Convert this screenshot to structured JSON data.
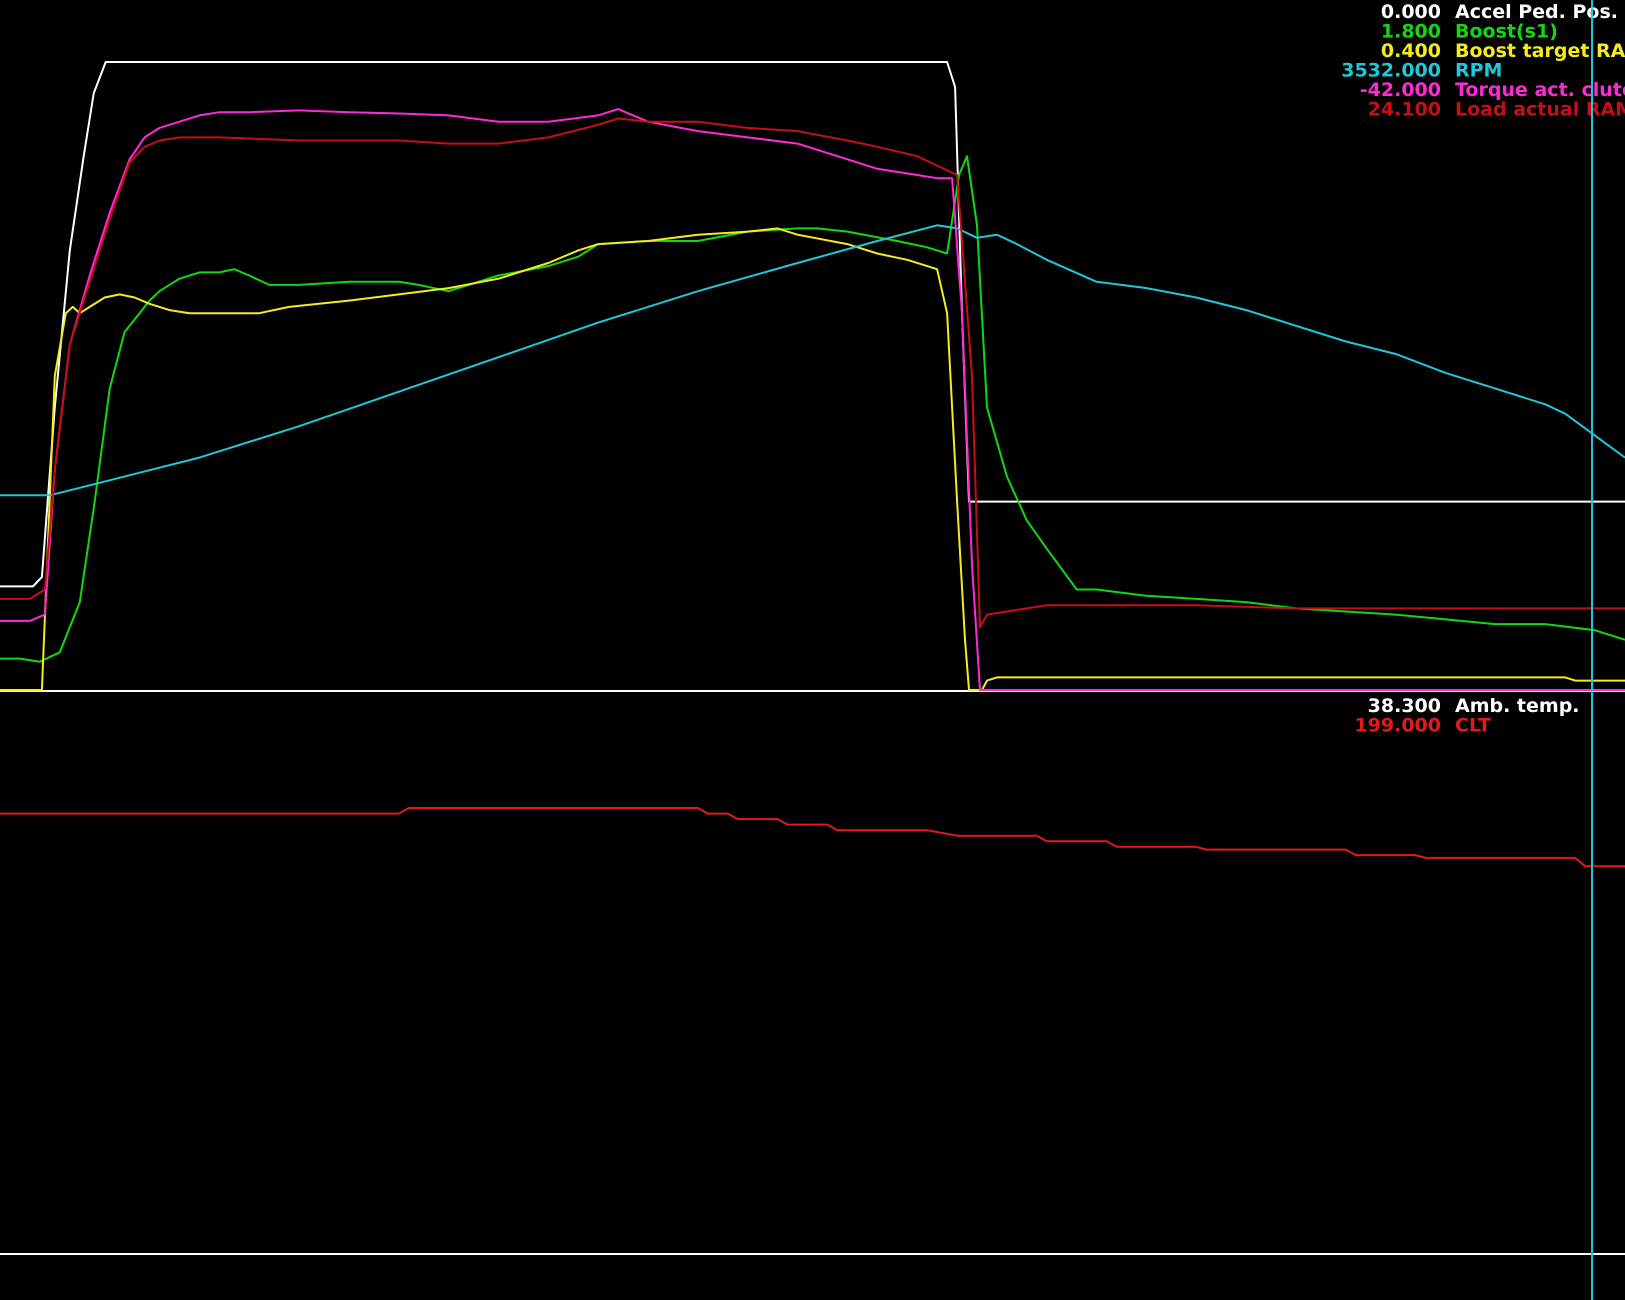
{
  "window": {
    "background": "#000000"
  },
  "cursor": {
    "color": "#1fc8d8",
    "x_fraction": 0.9797
  },
  "chart_data": [
    {
      "type": "line",
      "panel": "upper",
      "title": "",
      "xlabel": "",
      "ylabel": "",
      "legend_position": "top-right",
      "x_range": [
        0,
        163
      ],
      "y_range": [
        0,
        100
      ],
      "baseline_color": "#ffffff",
      "series": [
        {
          "name": "Accel Ped. Pos.",
          "cursor_value": "0.000",
          "color": "#ffffff",
          "x": [
            0,
            3.3,
            4.2,
            5.5,
            7,
            8.4,
            9.4,
            10.6,
            95,
            95.8,
            96.5,
            97.2,
            163
          ],
          "y": [
            16.5,
            16.5,
            18,
            45,
            70,
            85,
            95,
            100,
            100,
            96,
            60,
            30,
            30
          ]
        },
        {
          "name": "Boost(s1)",
          "cursor_value": "1.800",
          "color": "#11d911",
          "x": [
            0,
            2,
            4,
            6,
            8,
            9.5,
            11,
            12.5,
            14,
            15,
            16,
            18,
            20,
            22,
            23.5,
            25,
            27,
            30,
            35,
            40,
            42,
            45,
            50,
            55,
            58,
            60,
            65,
            70,
            75,
            80,
            82,
            85,
            90,
            93,
            95,
            96.2,
            97,
            98,
            99,
            101,
            103,
            105,
            108,
            110,
            115,
            120,
            125,
            130,
            140,
            150,
            155,
            160,
            163
          ],
          "y": [
            5,
            5,
            4.5,
            6,
            14,
            30,
            48,
            57,
            60,
            62,
            63.5,
            65.5,
            66.5,
            66.5,
            67,
            66,
            64.5,
            64.5,
            65,
            65,
            64.5,
            63.5,
            66,
            67.5,
            69,
            71,
            71.5,
            71.5,
            73,
            73.5,
            73.5,
            73,
            71.5,
            70.5,
            69.5,
            82,
            85,
            74,
            45,
            34,
            27,
            22.5,
            16,
            16,
            15,
            14.5,
            14,
            13,
            12,
            10.5,
            10.5,
            9.5,
            8
          ]
        },
        {
          "name": "Boost target RAM",
          "cursor_value": "0.400",
          "color": "#f5ec1f",
          "x": [
            0,
            4.2,
            5.5,
            6.6,
            7.3,
            8,
            9,
            10.5,
            12,
            13.5,
            15,
            17,
            19,
            20.5,
            22,
            24,
            26,
            29,
            35,
            40,
            45,
            50,
            55,
            58,
            60,
            65,
            70,
            75,
            78,
            80,
            85,
            88,
            91,
            94,
            95,
            96,
            96.8,
            97.2,
            98.5,
            99,
            100,
            110,
            120,
            130,
            140,
            150,
            157,
            158,
            163
          ],
          "y": [
            0,
            0,
            50,
            60,
            61,
            60,
            61,
            62.5,
            63,
            62.5,
            61.5,
            60.5,
            60,
            60,
            60,
            60,
            60,
            61,
            62,
            63,
            64,
            65.5,
            68,
            70,
            71,
            71.5,
            72.5,
            73,
            73.5,
            72.5,
            71,
            69.5,
            68.5,
            67,
            60,
            30,
            8,
            0,
            0,
            1.5,
            2,
            2,
            2,
            2,
            2,
            2,
            2,
            1.5,
            1.5
          ]
        },
        {
          "name": "RPM",
          "cursor_value": "3532.000",
          "color": "#1fc8d8",
          "x": [
            0,
            5,
            10,
            20,
            30,
            40,
            50,
            60,
            70,
            80,
            88,
            94,
            96,
            98,
            100,
            102,
            105,
            110,
            115,
            120,
            125,
            130,
            135,
            140,
            145,
            150,
            155,
            157,
            160,
            163
          ],
          "y": [
            31,
            31,
            33,
            37,
            42,
            47.5,
            53,
            58.5,
            63.5,
            68,
            71.5,
            74,
            73.5,
            72,
            72.5,
            71,
            68.5,
            65,
            64,
            62.5,
            60.5,
            58,
            55.5,
            53.5,
            50.5,
            48,
            45.5,
            44,
            40.5,
            37
          ]
        },
        {
          "name": "Torque act. clutch",
          "cursor_value": "-42.000",
          "color": "#ff2ad6",
          "x": [
            0,
            3,
            4.5,
            5.5,
            7,
            9,
            11,
            13,
            14.5,
            16,
            18,
            20,
            22,
            25,
            30,
            35,
            40,
            45,
            50,
            55,
            60,
            62,
            65,
            70,
            75,
            80,
            85,
            88,
            92,
            94,
            95.5,
            96.5,
            97.5,
            98.3,
            99,
            163
          ],
          "y": [
            11,
            11,
            12,
            35,
            55,
            66,
            76,
            84.5,
            88,
            89.5,
            90.5,
            91.5,
            92,
            92,
            92.3,
            92,
            91.8,
            91.5,
            90.5,
            90.5,
            91.5,
            92.5,
            90.5,
            89,
            88,
            87,
            84.5,
            83,
            82,
            81.5,
            81.5,
            60,
            20,
            0,
            0,
            0
          ]
        },
        {
          "name": "Load actual RAM",
          "cursor_value": "24.100",
          "color": "#c40f17",
          "x": [
            0,
            3,
            4.5,
            5.5,
            7,
            9,
            11,
            13,
            14.5,
            16,
            18,
            20,
            22,
            30,
            40,
            45,
            50,
            55,
            60,
            62,
            65,
            70,
            75,
            80,
            85,
            88,
            92,
            94,
            96,
            97.5,
            98.3,
            99,
            101,
            105,
            110,
            120,
            130,
            140,
            150,
            163
          ],
          "y": [
            14.5,
            14.5,
            16,
            35,
            55,
            65,
            75,
            84,
            86.5,
            87.5,
            88,
            88,
            88,
            87.5,
            87.5,
            87,
            87,
            88,
            90,
            91,
            90.5,
            90.5,
            89.5,
            89,
            87.5,
            86.5,
            85,
            83.5,
            82,
            50,
            10,
            12,
            12.5,
            13.5,
            13.5,
            13.5,
            13,
            13,
            13,
            13
          ]
        }
      ]
    },
    {
      "type": "line",
      "panel": "lower",
      "title": "",
      "xlabel": "",
      "ylabel": "",
      "legend_position": "top-right",
      "x_range": [
        0,
        163
      ],
      "y_range": [
        185,
        205
      ],
      "series": [
        {
          "name": "Amb. temp.",
          "cursor_value": "38.300",
          "color": "#ffffff",
          "x": [],
          "y": []
        },
        {
          "name": "CLT",
          "cursor_value": "199.000",
          "color": "#e21a1a",
          "x": [
            0,
            40,
            41,
            70,
            71,
            73,
            74,
            78,
            79,
            83,
            84,
            93,
            96,
            104,
            105,
            111,
            112,
            120,
            121,
            135,
            136,
            142,
            143,
            158,
            159,
            163
          ],
          "y": [
            200.9,
            200.9,
            201.1,
            201.1,
            200.9,
            200.9,
            200.7,
            200.7,
            200.5,
            200.5,
            200.3,
            200.3,
            200.1,
            200.1,
            199.9,
            199.9,
            199.7,
            199.7,
            199.6,
            199.6,
            199.4,
            199.4,
            199.3,
            199.3,
            199.0,
            199.0
          ]
        }
      ]
    }
  ]
}
